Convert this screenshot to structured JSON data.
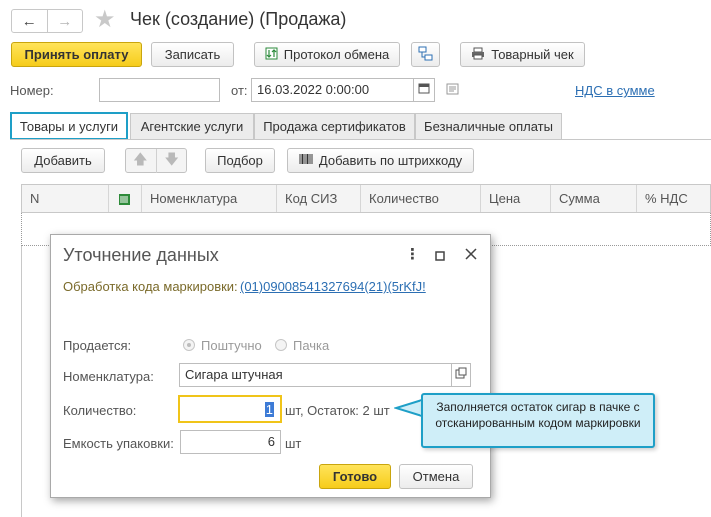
{
  "window": {
    "title": "Чек (создание) (Продажа)"
  },
  "nav": {
    "back": "←",
    "forward": "→",
    "favorite": "★"
  },
  "toolbar": {
    "accept_payment": "Принять оплату",
    "save": "Записать",
    "exchange_log": "Протокол обмена",
    "goods_receipt": "Товарный чек"
  },
  "header": {
    "number_label": "Номер:",
    "number_value": "",
    "date_label": "от:",
    "date_value": "16.03.2022  0:00:00",
    "vat_link": "НДС в сумме"
  },
  "tabs": [
    {
      "label": "Товары и услуги"
    },
    {
      "label": "Агентские услуги"
    },
    {
      "label": "Продажа сертификатов"
    },
    {
      "label": "Безналичные оплаты"
    }
  ],
  "table_toolbar": {
    "add": "Добавить",
    "select": "Подбор",
    "add_barcode": "Добавить по штрихкоду"
  },
  "table": {
    "columns": [
      "N",
      "",
      "Номенклатура",
      "Код СИЗ",
      "Количество",
      "Цена",
      "Сумма",
      "% НДС"
    ]
  },
  "dialog": {
    "title": "Уточнение данных",
    "marking_label": "Обработка кода маркировки:",
    "marking_code": "(01)09008541327694(21)(5rKfJ!",
    "sold_label": "Продается:",
    "sold_options": [
      "Поштучно",
      "Пачка"
    ],
    "nomenclature_label": "Номенклатура:",
    "nomenclature_value": "Сигара штучная",
    "quantity_label": "Количество:",
    "quantity_value": "1",
    "quantity_suffix": "шт, Остаток: 2 шт",
    "capacity_label": "Емкость упаковки:",
    "capacity_value": "6",
    "capacity_unit": "шт",
    "ok": "Готово",
    "cancel": "Отмена"
  },
  "callout": {
    "text": "Заполняется остаток сигар в пачке с отсканированным кодом маркировки"
  }
}
